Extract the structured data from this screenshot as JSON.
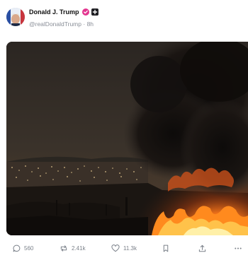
{
  "post": {
    "author": {
      "display_name": "Donald J. Trump",
      "handle": "@realDonaldTrump",
      "time_ago": "8h",
      "verified_color": "#e3358f"
    },
    "media": {
      "description_icon": "photo"
    },
    "actions": {
      "replies": "560",
      "reposts": "2.41k",
      "likes": "11.3k"
    }
  },
  "icons": {
    "reply": "comment-bubble-icon",
    "repost": "repost-arrows-icon",
    "like": "heart-icon",
    "bookmark": "bookmark-icon",
    "share": "share-upload-icon",
    "more": "more-dots-icon",
    "verified": "verified-check-icon",
    "plus": "plus-badge-icon"
  }
}
